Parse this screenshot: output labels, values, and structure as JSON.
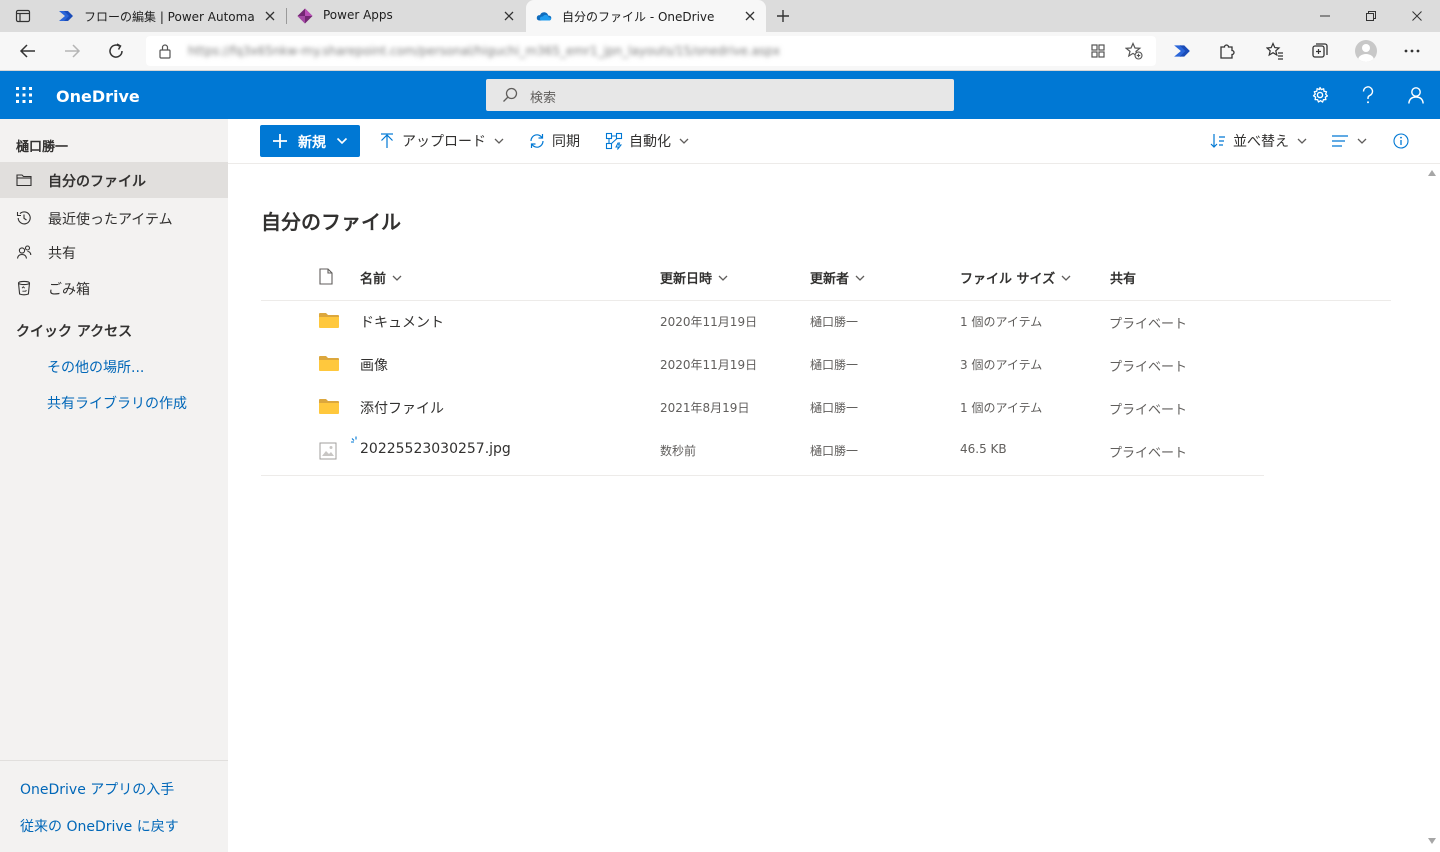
{
  "browser": {
    "tabs": [
      {
        "title": "フローの編集 | Power Automate",
        "favicon": "power-automate-icon",
        "active": false
      },
      {
        "title": "Power Apps",
        "favicon": "power-apps-icon",
        "active": false
      },
      {
        "title": "自分のファイル - OneDrive",
        "favicon": "onedrive-cloud-icon",
        "active": true
      }
    ],
    "url": "https://fq3x65nkw-my.sharepoint.com/personal/higuchi_m365_emr1_jpn_layouts/15/onedrive.aspx"
  },
  "suite": {
    "app_name": "OneDrive",
    "search_placeholder": "検索",
    "brand_color": "#0078d4"
  },
  "leftnav": {
    "user_name": "樋口勝一",
    "items": [
      {
        "label": "自分のファイル",
        "icon": "folder-icon",
        "selected": true
      },
      {
        "label": "最近使ったアイテム",
        "icon": "history-icon",
        "selected": false
      },
      {
        "label": "共有",
        "icon": "people-icon",
        "selected": false
      },
      {
        "label": "ごみ箱",
        "icon": "recycle-bin-icon",
        "selected": false
      }
    ],
    "quick_access": {
      "heading": "クイック アクセス",
      "links": [
        "その他の場所...",
        "共有ライブラリの作成"
      ]
    },
    "footer_links": [
      "OneDrive アプリの入手",
      "従来の OneDrive に戻す"
    ]
  },
  "commandbar": {
    "new_label": "新規",
    "upload_label": "アップロード",
    "sync_label": "同期",
    "automate_label": "自動化",
    "sort_label": "並べ替え"
  },
  "main": {
    "title": "自分のファイル",
    "columns": {
      "name": "名前",
      "modified": "更新日時",
      "modified_by": "更新者",
      "size": "ファイル サイズ",
      "sharing": "共有"
    },
    "rows": [
      {
        "type": "folder",
        "name": "ドキュメント",
        "modified": "2020年11月19日",
        "modified_by": "樋口勝一",
        "size": "1 個のアイテム",
        "sharing": "プライベート"
      },
      {
        "type": "folder",
        "name": "画像",
        "modified": "2020年11月19日",
        "modified_by": "樋口勝一",
        "size": "3 個のアイテム",
        "sharing": "プライベート"
      },
      {
        "type": "folder",
        "name": "添付ファイル",
        "modified": "2021年8月19日",
        "modified_by": "樋口勝一",
        "size": "1 個のアイテム",
        "sharing": "プライベート"
      },
      {
        "type": "image",
        "name": "20225523030257.jpg",
        "modified": "数秒前",
        "modified_by": "樋口勝一",
        "size": "46.5 KB",
        "sharing": "プライベート",
        "is_new": true
      }
    ]
  }
}
